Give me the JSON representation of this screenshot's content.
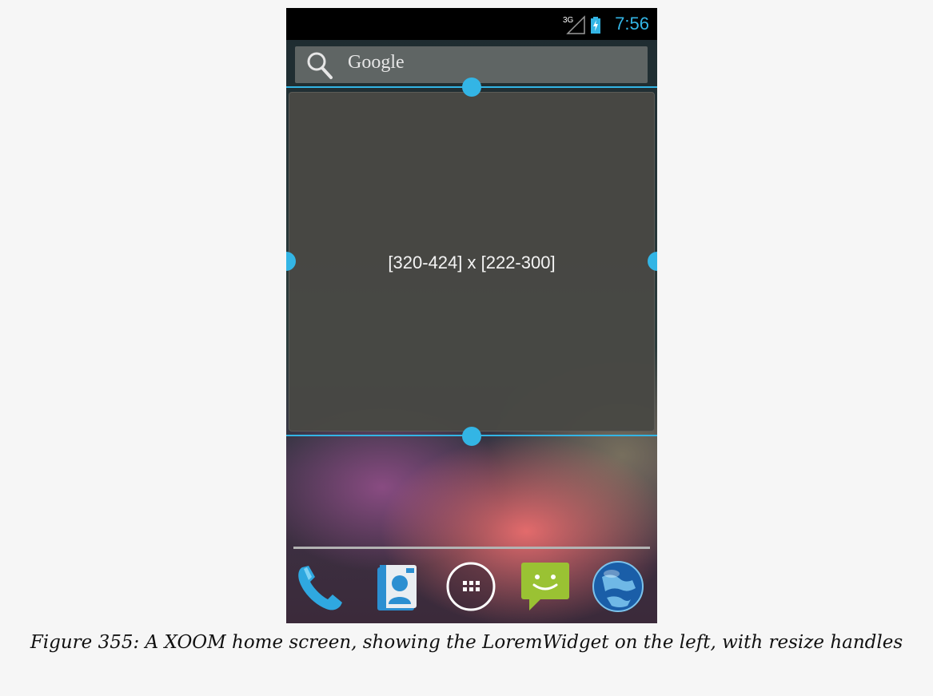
{
  "status_bar": {
    "network": "3G",
    "time": "7:56",
    "icons": [
      "signal-icon",
      "battery-charging-icon"
    ]
  },
  "search": {
    "label": "Google",
    "icon": "search-icon"
  },
  "widget": {
    "size_text": "[320-424] x [222-300]"
  },
  "dock": {
    "icons": [
      "phone-icon",
      "contacts-icon",
      "all-apps-icon",
      "messaging-icon",
      "browser-icon"
    ]
  },
  "caption": "Figure 355: A XOOM home screen, showing the LoremWidget on the left, with resize handles",
  "colors": {
    "accent": "#33b5e5",
    "widget_bg": "#484844",
    "page_bg": "#f6f6f6"
  }
}
